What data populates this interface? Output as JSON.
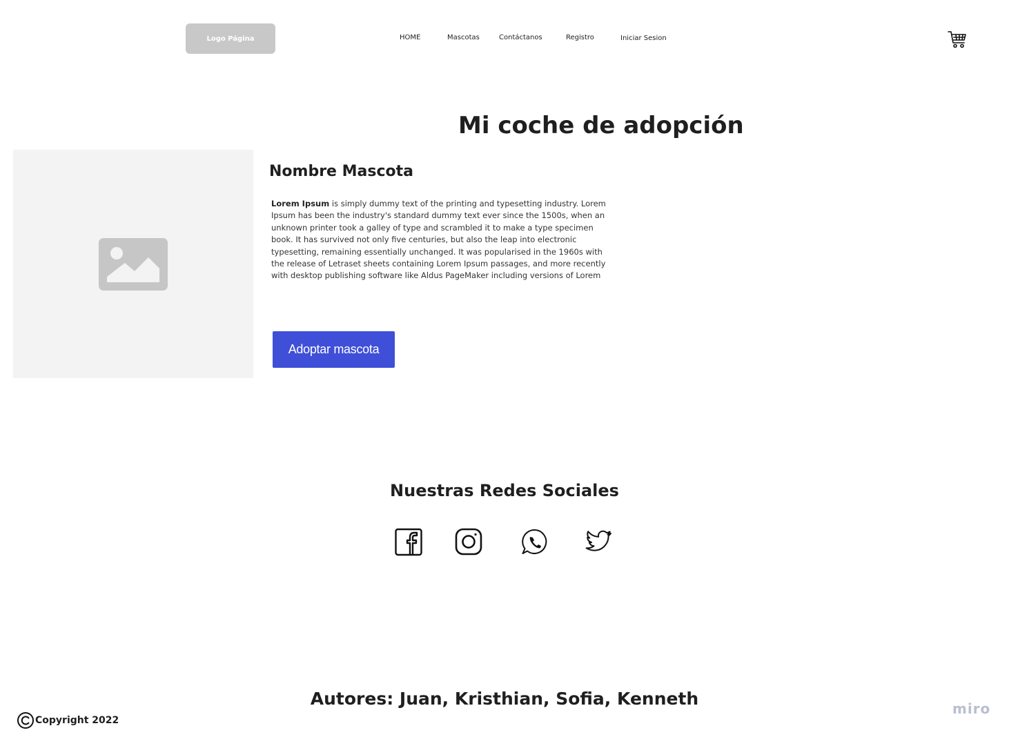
{
  "header": {
    "logo_label": "Logo Página",
    "nav": [
      "HOME",
      "Mascotas",
      "Contáctanos",
      "Registro",
      "Iniciar Sesion"
    ]
  },
  "main": {
    "title": "Mi coche de adopción",
    "pet_name": "Nombre Mascota",
    "description_bold": "Lorem Ipsum",
    "description_rest": " is simply dummy text of the printing and typesetting industry. Lorem Ipsum has been the industry's standard dummy text ever since the 1500s, when an unknown printer took a galley of type and scrambled it to make a type specimen book. It has survived not only five centuries, but also the leap into electronic typesetting, remaining essentially unchanged. It was popularised in the 1960s with the release of Letraset sheets containing Lorem Ipsum passages, and more recently with desktop publishing software like Aldus PageMaker including versions of Lorem",
    "adopt_button": "Adoptar mascota"
  },
  "social": {
    "title": "Nuestras Redes Sociales",
    "icons": [
      "facebook-icon",
      "instagram-icon",
      "whatsapp-icon",
      "twitter-icon"
    ]
  },
  "footer": {
    "authors": "Autores: Juan, Kristhian, Sofia, Kenneth",
    "copyright": "Copyright 2022",
    "watermark": "miro"
  },
  "colors": {
    "accent": "#3f4fd8",
    "placeholder_bg": "#f3f3f3",
    "logo_bg": "#c8c8c8"
  }
}
